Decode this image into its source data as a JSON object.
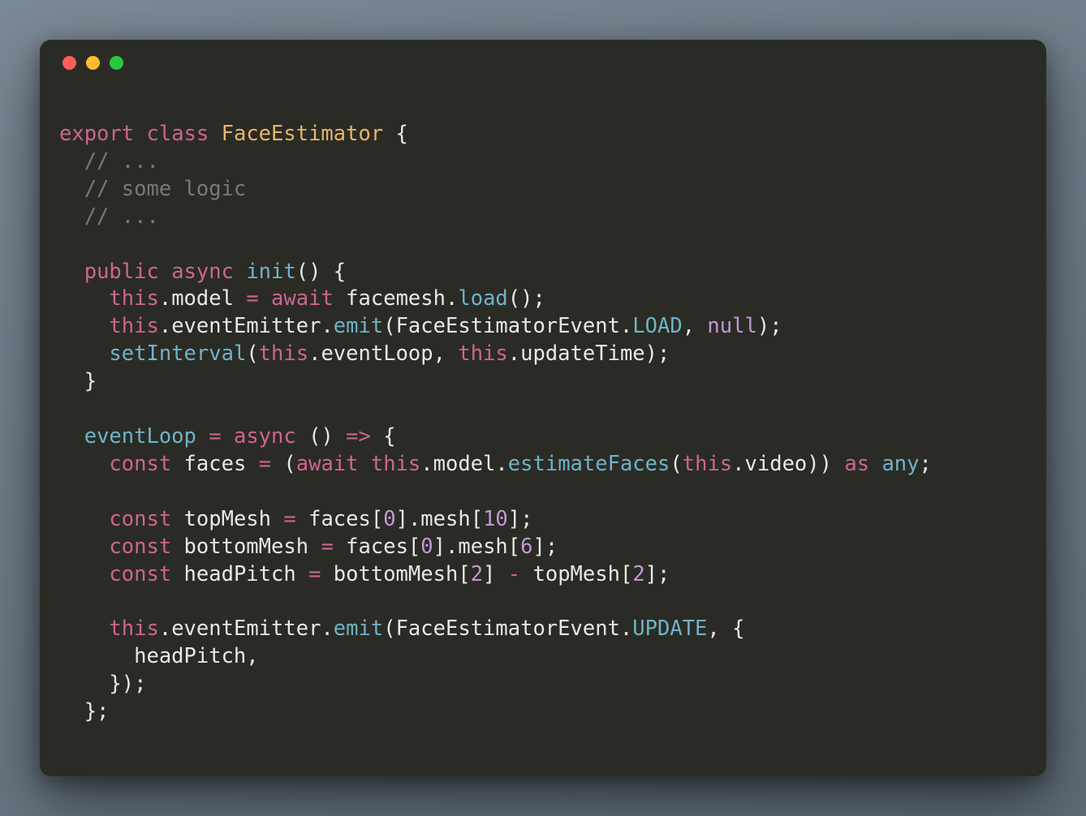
{
  "traffic": {
    "red": "close-window",
    "yellow": "minimize-window",
    "green": "maximize-window"
  },
  "code": {
    "l01": {
      "export": "export",
      "class": "class",
      "name": "FaceEstimator",
      "brace": " {"
    },
    "l02": "  // ...",
    "l03": "  // some logic",
    "l04": "  // ...",
    "l05": "",
    "l06": {
      "indent": "  ",
      "public": "public",
      "async": "async",
      "fn": "init",
      "tail": "() {"
    },
    "l07": {
      "indent": "    ",
      "this1": "this",
      "dot1": ".",
      "model": "model",
      "sp": " ",
      "eq": "=",
      "sp2": " ",
      "await": "await",
      "sp3": " ",
      "obj": "facemesh",
      "dot2": ".",
      "load": "load",
      "tail": "();"
    },
    "l08": {
      "indent": "    ",
      "this1": "this",
      "dot1": ".",
      "ee": "eventEmitter",
      "dot2": ".",
      "emit": "emit",
      "open": "(",
      "cls": "FaceEstimatorEvent",
      "dot3": ".",
      "LOAD": "LOAD",
      "comma": ", ",
      "null": "null",
      "close": ");"
    },
    "l09": {
      "indent": "    ",
      "fn": "setInterval",
      "open": "(",
      "this1": "this",
      "dot1": ".",
      "el": "eventLoop",
      "comma": ", ",
      "this2": "this",
      "dot2": ".",
      "ut": "updateTime",
      "close": ");"
    },
    "l10": "  }",
    "l11": "",
    "l12": {
      "indent": "  ",
      "name": "eventLoop",
      "sp": " ",
      "eq": "=",
      "sp2": " ",
      "async": "async",
      "sp3": " ",
      "parens": "()",
      "sp4": " ",
      "arrow": "=>",
      "sp5": " ",
      "brace": "{"
    },
    "l13": {
      "indent": "    ",
      "const": "const",
      "sp": " ",
      "faces": "faces",
      "sp2": " ",
      "eq": "=",
      "sp3": " (",
      "await": "await",
      "sp4": " ",
      "this": "this",
      "dot1": ".",
      "model": "model",
      "dot2": ".",
      "ef": "estimateFaces",
      "open": "(",
      "this2": "this",
      "dot3": ".",
      "video": "video",
      "close": "))",
      "sp5": " ",
      "as": "as",
      "sp6": " ",
      "any": "any",
      "semi": ";"
    },
    "l14": "",
    "l15": {
      "indent": "    ",
      "const": "const",
      "sp": " ",
      "var": "topMesh",
      "sp2": " ",
      "eq": "=",
      "sp3": " ",
      "faces": "faces",
      "b1o": "[",
      "n0": "0",
      "b1c": "]",
      "dot": ".",
      "mesh": "mesh",
      "b2o": "[",
      "n10": "10",
      "b2c": "];"
    },
    "l16": {
      "indent": "    ",
      "const": "const",
      "sp": " ",
      "var": "bottomMesh",
      "sp2": " ",
      "eq": "=",
      "sp3": " ",
      "faces": "faces",
      "b1o": "[",
      "n0": "0",
      "b1c": "]",
      "dot": ".",
      "mesh": "mesh",
      "b2o": "[",
      "n6": "6",
      "b2c": "];"
    },
    "l17": {
      "indent": "    ",
      "const": "const",
      "sp": " ",
      "var": "headPitch",
      "sp2": " ",
      "eq": "=",
      "sp3": " ",
      "bm": "bottomMesh",
      "b1o": "[",
      "n2a": "2",
      "b1c": "]",
      "sp4": " ",
      "minus": "-",
      "sp5": " ",
      "tm": "topMesh",
      "b2o": "[",
      "n2b": "2",
      "b2c": "];"
    },
    "l18": "",
    "l19": {
      "indent": "    ",
      "this": "this",
      "dot1": ".",
      "ee": "eventEmitter",
      "dot2": ".",
      "emit": "emit",
      "open": "(",
      "cls": "FaceEstimatorEvent",
      "dot3": ".",
      "UPDATE": "UPDATE",
      "tail": ", {"
    },
    "l20": "      headPitch,",
    "l21": "    });",
    "l22": "  };"
  }
}
